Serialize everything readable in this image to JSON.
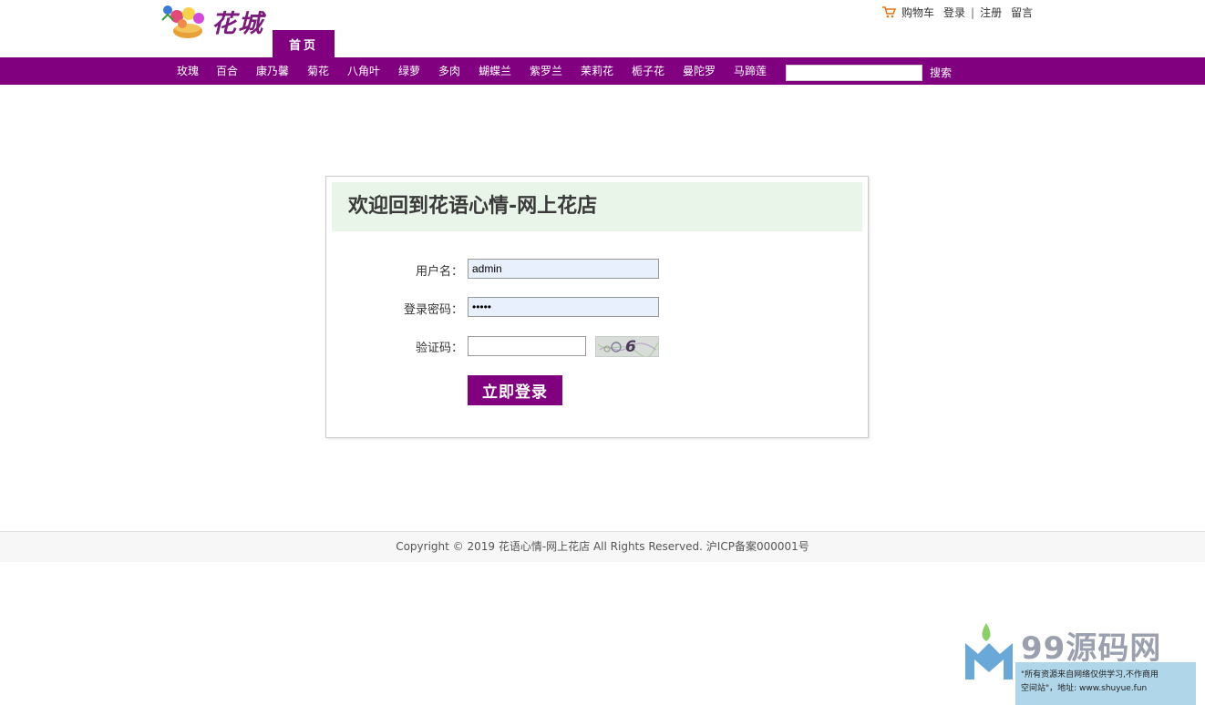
{
  "header": {
    "logo_text": "花城",
    "home_tab": "首页",
    "links": {
      "cart": "购物车",
      "login": "登录",
      "separator": "|",
      "register": "注册",
      "message": "留言"
    }
  },
  "nav": {
    "categories": [
      "玫瑰",
      "百合",
      "康乃馨",
      "菊花",
      "八角叶",
      "绿萝",
      "多肉",
      "蝴蝶兰",
      "紫罗兰",
      "茉莉花",
      "栀子花",
      "曼陀罗",
      "马蹄莲"
    ],
    "search": {
      "value": "",
      "button": "搜索"
    }
  },
  "login": {
    "title": "欢迎回到花语心情-网上花店",
    "username_label": "用户名：",
    "username_value": "admin",
    "password_label": "登录密码：",
    "password_value": "•••••",
    "captcha_label": "验证码：",
    "captcha_value": "",
    "captcha_image_text": "6",
    "submit": "立即登录"
  },
  "footer": {
    "copyright": "Copyright © 2019 花语心情-网上花店 All Rights Reserved. 沪ICP备案000001号"
  },
  "watermark": {
    "brand": "99源码网",
    "line1": "\"所有资源来自网络仅供学习,不作商用",
    "line2": "空间站\"，地址: www.shuyue.fun"
  },
  "colors": {
    "brand_purple": "#800080",
    "panel_header_bg": "#e8f5e8",
    "autofill_bg": "#e8f0fe"
  }
}
